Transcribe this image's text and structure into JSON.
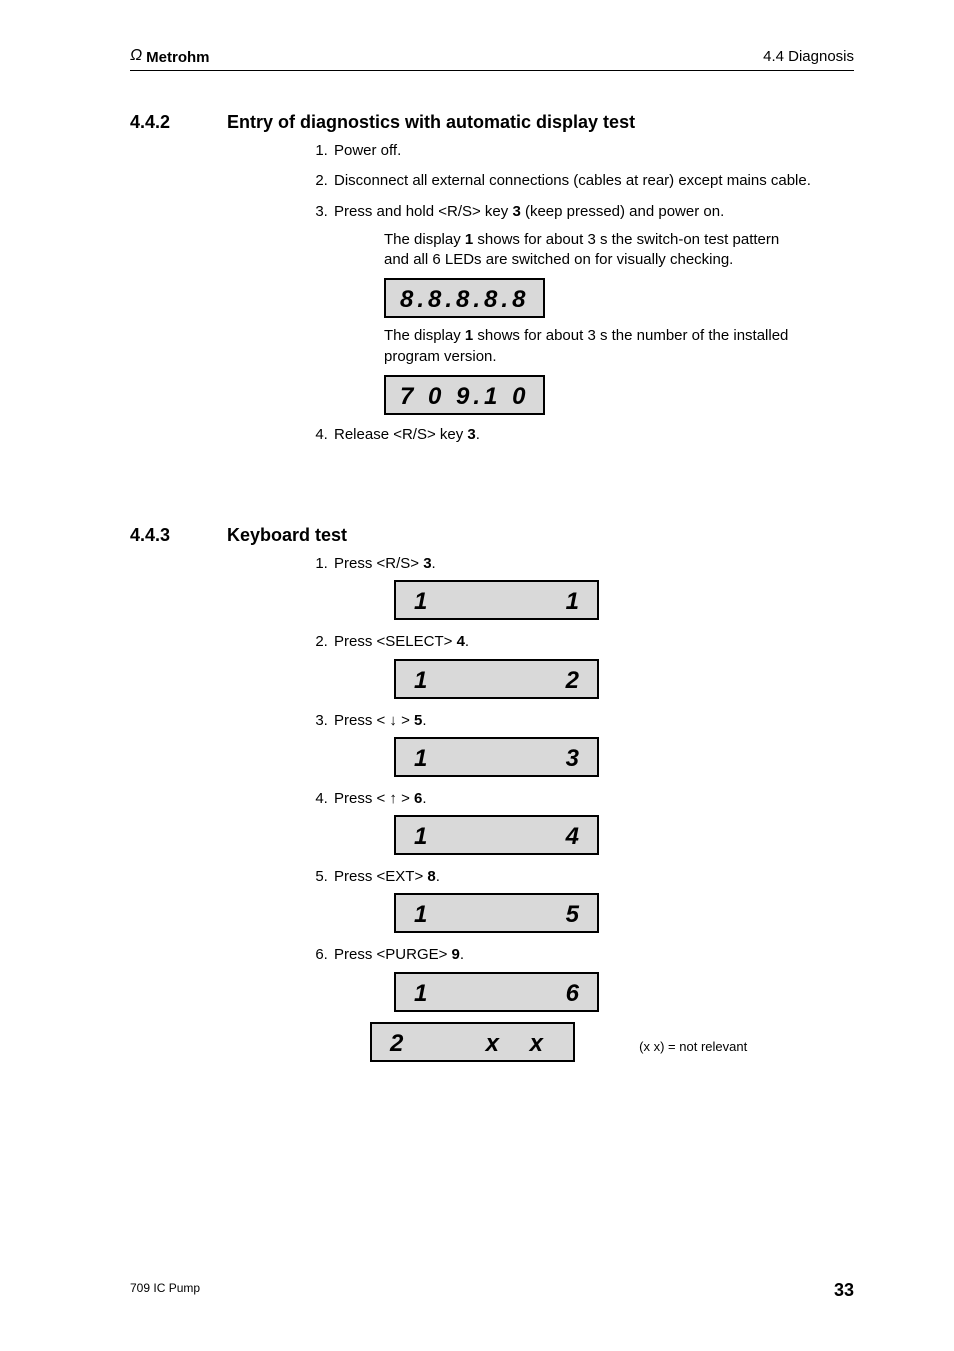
{
  "header": {
    "brand_omega": "Ω",
    "brand_name": "Metrohm",
    "right": "4.4  Diagnosis"
  },
  "footer": {
    "left": "709 IC Pump",
    "page": "33"
  },
  "sec1": {
    "num": "4.4.2",
    "title": "Entry of diagnostics with automatic display test",
    "steps": {
      "s1": "Power off.",
      "s2": "Disconnect all external connections (cables at rear) except mains cable.",
      "s3_a": "Press and hold <R/S> key ",
      "s3_key": "3",
      "s3_b": " (keep pressed) and power on.",
      "s3_p1a": "The display ",
      "s3_p1key": "1",
      "s3_p1b": " shows for about 3 s the switch-on test pattern and all 6 LEDs are switched on for visually checking.",
      "disp1": "8.8.8.8.8",
      "s3_p2a": "The display ",
      "s3_p2key": "1",
      "s3_p2b": " shows for about 3 s the number of the installed program version.",
      "disp2": "7 0 9.1 0",
      "s4_a": "Release <R/S> key ",
      "s4_key": "3",
      "s4_b": "."
    }
  },
  "sec2": {
    "num": "4.4.3",
    "title": "Keyboard test",
    "steps": [
      {
        "text_a": "Press <R/S> ",
        "key": "3",
        "left": "1",
        "right": "1"
      },
      {
        "text_a": "Press <SELECT> ",
        "key": "4",
        "left": "1",
        "right": "2"
      },
      {
        "text_a": "Press < ↓ > ",
        "key": "5",
        "left": "1",
        "right": "3"
      },
      {
        "text_a": "Press < ↑ > ",
        "key": "6",
        "left": "1",
        "right": "4"
      },
      {
        "text_a": "Press <EXT> ",
        "key": "8",
        "left": "1",
        "right": "5"
      },
      {
        "text_a": "Press <PURGE> ",
        "key": "9",
        "left": "1",
        "right": "6"
      }
    ],
    "extra": {
      "left": "2",
      "right": "x x"
    },
    "annot": "(x x) = not relevant"
  }
}
